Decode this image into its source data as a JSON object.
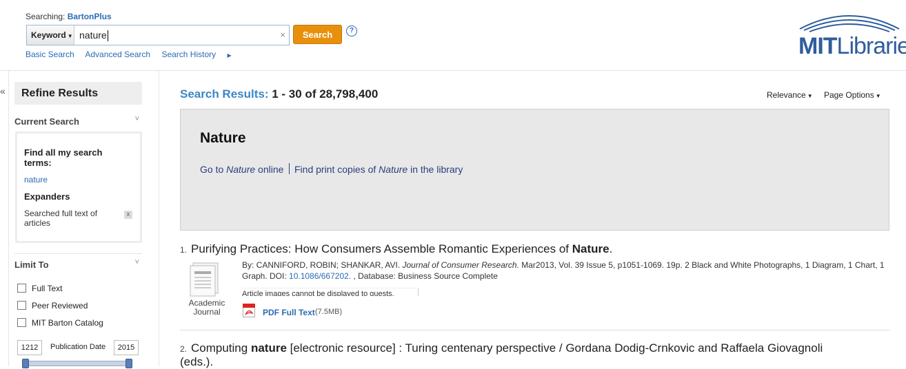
{
  "header": {
    "searching_label": "Searching:",
    "database": "BartonPlus",
    "field_select": "Keyword",
    "query": "nature",
    "clear": "×",
    "search_button": "Search",
    "help": "?",
    "links": [
      "Basic Search",
      "Advanced Search",
      "Search History"
    ],
    "logo": {
      "part1": "MIT",
      "part2": "Libraries"
    }
  },
  "sidebar": {
    "collapse": "«",
    "refine_title": "Refine Results",
    "current_search": {
      "heading": "Current Search",
      "find_all_label": "Find all my search terms:",
      "term": "nature",
      "expanders_label": "Expanders",
      "expander": "Searched full text of articles",
      "remove": "x"
    },
    "limit_to": {
      "heading": "Limit To",
      "options": [
        "Full Text",
        "Peer Reviewed",
        "MIT Barton Catalog"
      ]
    },
    "pub_date": {
      "label": "Publication Date",
      "from": "1212",
      "to": "2015"
    }
  },
  "results": {
    "label": "Search Results:",
    "count": "1 - 30 of 28,798,400",
    "relevance": "Relevance",
    "page_options": "Page Options",
    "feature": {
      "title": "Nature",
      "link1_pre": "Go to ",
      "link1_em": "Nature",
      "link1_post": " online",
      "link2_pre": "Find print copies of ",
      "link2_em": "Nature",
      "link2_post": " in the library"
    },
    "items": [
      {
        "num": "1.",
        "title_pre": "Purifying Practices: How Consumers Assemble Romantic Experiences of ",
        "title_bold": "Nature",
        "title_post": ".",
        "doc_type": "Academic Journal",
        "by": "By: CANNIFORD, ROBIN; SHANKAR, AVI. ",
        "journal": "Journal of Consumer Research.",
        "details": " Mar2013, Vol. 39 Issue 5, p1051-1069. 19p. 2 Black and White Photographs, 1 Diagram, 1 Chart, 1 Graph. DOI: ",
        "doi": "10.1086/667202.",
        "database": " , Database: Business Source Complete",
        "image_msg": "Article images cannot be displayed to guests.",
        "pdf_label": "PDF Full Text",
        "pdf_size": "(7.5MB)"
      },
      {
        "num": "2.",
        "title_pre": "Computing ",
        "title_bold": "nature",
        "title_post": " [electronic resource] : Turing centenary perspective / Gordana Dodig-Crnkovic and Raffaela Giovagnoli (eds.)."
      }
    ]
  },
  "colors": {
    "accent": "#e8900c",
    "link": "#2a6bb3",
    "heading_blue": "#3c86c6"
  }
}
